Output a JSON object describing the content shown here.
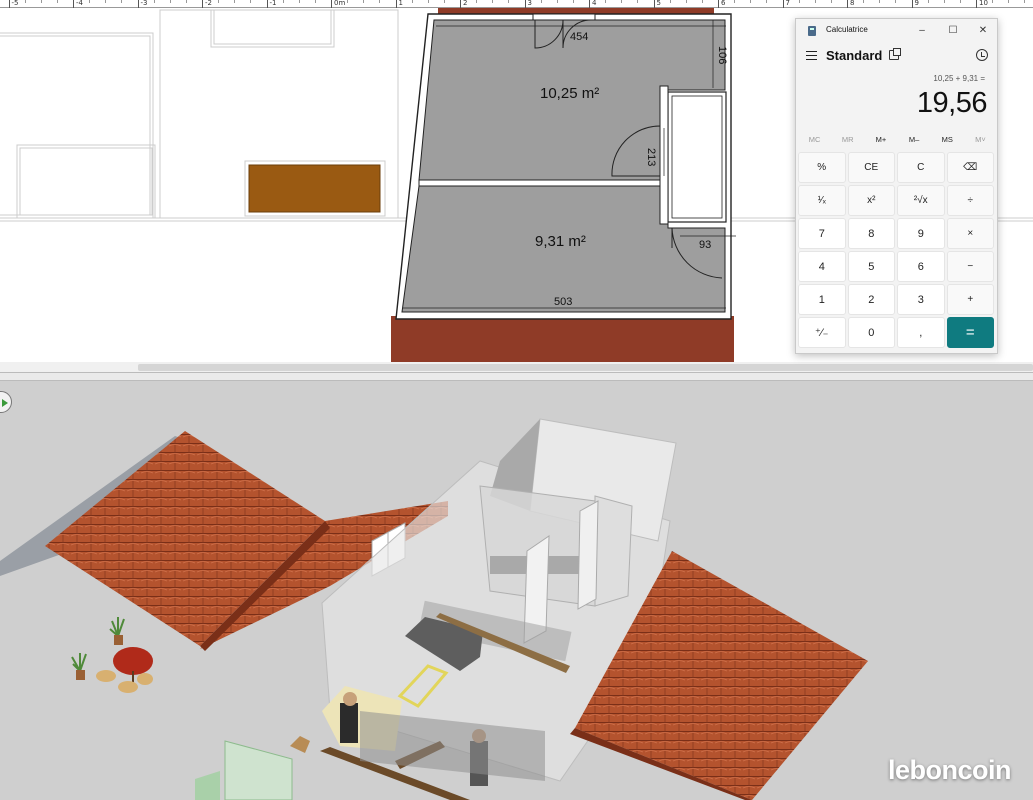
{
  "plan": {
    "rooms": [
      {
        "label": "10,25 m²"
      },
      {
        "label": "9,31 m²"
      }
    ],
    "dimensions": {
      "top": "454",
      "right_top": "106",
      "door_mid": "213",
      "door_small": "93",
      "bottom": "503"
    },
    "ruler": [
      "-5",
      "-4",
      "-3",
      "-2",
      "-1",
      "0m",
      "1",
      "2",
      "3",
      "4",
      "5",
      "6",
      "7",
      "8",
      "9",
      "10"
    ],
    "colors": {
      "floor": "#9e9e9e",
      "wall": "#ffffff",
      "furniture": "#9a5a12",
      "roof_tile": "#8f3b27"
    }
  },
  "calculator": {
    "title": "Calculatrice",
    "mode": "Standard",
    "controls": {
      "minimize": "–",
      "maximize": "☐",
      "close": "✕"
    },
    "expression": "10,25 + 9,31 =",
    "display": "19,56",
    "memory": [
      "MC",
      "MR",
      "M+",
      "M–",
      "MS",
      "M˅"
    ],
    "keys": [
      "%",
      "CE",
      "C",
      "⌫",
      "¹⁄ₓ",
      "x²",
      "²√x",
      "÷",
      "7",
      "8",
      "9",
      "×",
      "4",
      "5",
      "6",
      "−",
      "1",
      "2",
      "3",
      "+",
      "⁺⁄₋",
      "0",
      ",",
      "="
    ],
    "accent": "#0f7b80"
  },
  "view3d": {
    "watermark": "leboncoin",
    "colors": {
      "background": "#cfcfcf",
      "roof": "#b4532e",
      "glass": "#e8e8e8"
    }
  }
}
